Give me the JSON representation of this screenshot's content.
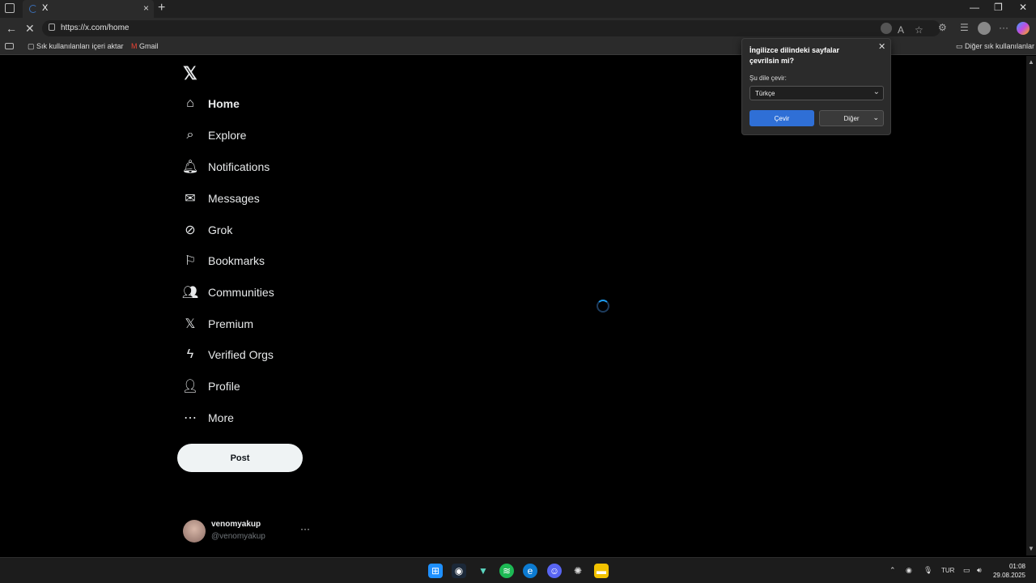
{
  "browser": {
    "tab_title": "X",
    "tab_close": "×",
    "new_tab": "+",
    "url": "https://x.com/home",
    "window_controls": [
      "—",
      "❐",
      "✕"
    ],
    "bookmarks": {
      "import": "Sık kullanılanları içeri aktar",
      "gmail": "Gmail",
      "other": "Diğer sık kullanılanlar"
    }
  },
  "translate_popup": {
    "title": "İngilizce dilindeki sayfalar çevrilsin mi?",
    "close": "✕",
    "label": "Şu dile çevir:",
    "selected_language": "Türkçe",
    "translate_button": "Çevir",
    "other_button": "Diğer"
  },
  "sidebar": {
    "logo": "𝕏",
    "items": [
      {
        "label": "Home",
        "icon": "home-icon"
      },
      {
        "label": "Explore",
        "icon": "search-icon"
      },
      {
        "label": "Notifications",
        "icon": "bell-icon"
      },
      {
        "label": "Messages",
        "icon": "envelope-icon"
      },
      {
        "label": "Grok",
        "icon": "grok-icon"
      },
      {
        "label": "Bookmarks",
        "icon": "bookmark-icon"
      },
      {
        "label": "Communities",
        "icon": "people-icon"
      },
      {
        "label": "Premium",
        "icon": "x-icon"
      },
      {
        "label": "Verified Orgs",
        "icon": "lightning-icon"
      },
      {
        "label": "Profile",
        "icon": "person-icon"
      },
      {
        "label": "More",
        "icon": "more-circle-icon"
      }
    ],
    "post_button": "Post",
    "account": {
      "name": "venomyakup",
      "handle": "@venomyakup",
      "more": "···"
    }
  },
  "taskbar": {
    "language": "TUR",
    "time": "01:08",
    "date": "29.08.2025"
  }
}
